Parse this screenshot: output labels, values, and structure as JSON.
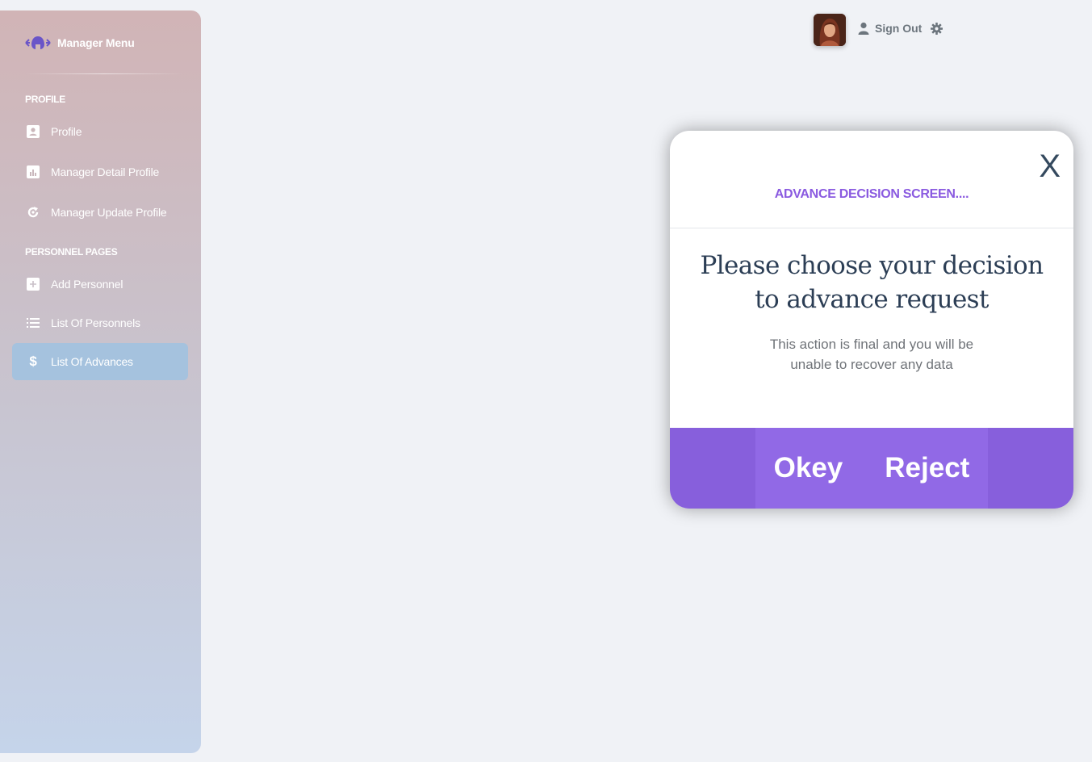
{
  "sidebar": {
    "brand": "Manager Menu",
    "sections": [
      {
        "title": "PROFILE"
      },
      {
        "title": "PERSONNEL PAGES"
      }
    ],
    "items": [
      {
        "label": "Profile",
        "icon": "profile-card-icon"
      },
      {
        "label": "Manager Detail Profile",
        "icon": "chart-icon"
      },
      {
        "label": "Manager Update Profile",
        "icon": "refresh-icon"
      },
      {
        "label": "Add Personnel",
        "icon": "plus-square-icon"
      },
      {
        "label": "List Of Personnels",
        "icon": "list-icon"
      },
      {
        "label": "List Of Advances",
        "icon": "dollar-icon",
        "active": true
      }
    ]
  },
  "header": {
    "signout_label": "Sign Out"
  },
  "modal": {
    "close_label": "X",
    "title": "ADVANCE DECISION SCREEN....",
    "heading": "Please choose your decision to advance request",
    "text": "This action is final and you will be unable to recover any data",
    "okey_label": "Okey",
    "reject_label": "Reject"
  },
  "colors": {
    "accent": "#875fdc",
    "title_purple": "#8a5ae0",
    "active_item": "#a5c2de"
  }
}
